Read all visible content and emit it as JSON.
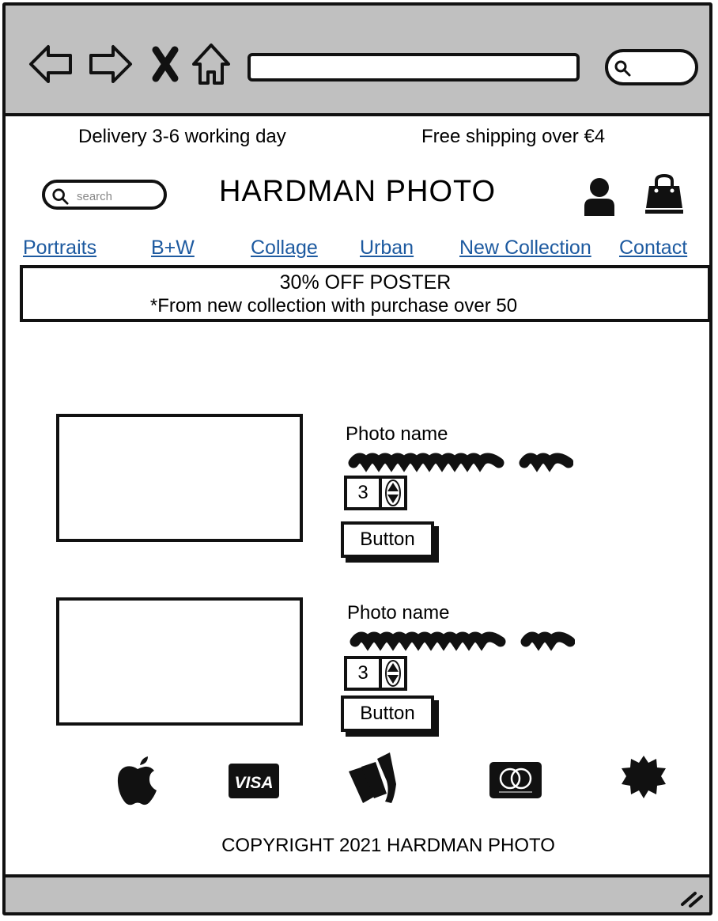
{
  "promo": {
    "delivery": "Delivery 3-6 working day",
    "shipping": "Free shipping over €4"
  },
  "header": {
    "search_placeholder": "search",
    "brand": "HARDMAN PHOTO"
  },
  "nav": {
    "items": [
      "Portraits",
      "B+W",
      "Collage",
      "Urban",
      "New Collection",
      "Contact"
    ]
  },
  "banner": {
    "line1": "30% OFF POSTER",
    "line2": "*From new collection with purchase over 50"
  },
  "products": [
    {
      "name": "Photo name",
      "quantity": "3",
      "button": "Button"
    },
    {
      "name": "Photo name",
      "quantity": "3",
      "button": "Button"
    }
  ],
  "payments": [
    "apple-pay-icon",
    "visa-icon",
    "webmoney-icon",
    "mastercard-icon",
    "badge-icon"
  ],
  "footer": {
    "copyright": "COPYRIGHT 2021 HARDMAN PHOTO"
  }
}
